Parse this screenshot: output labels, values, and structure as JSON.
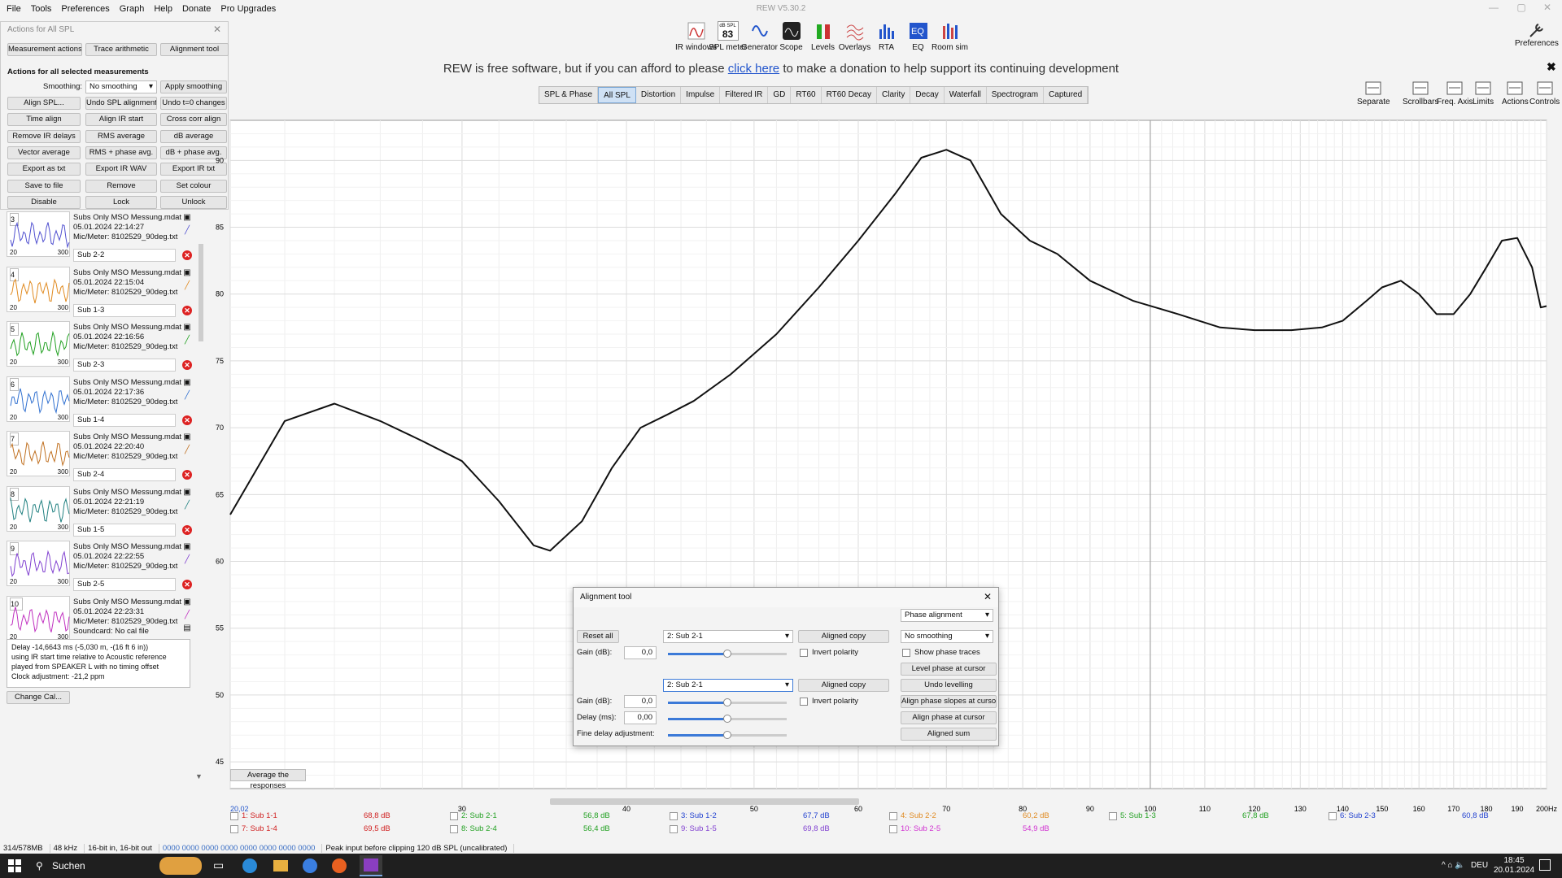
{
  "menu": [
    "File",
    "Tools",
    "Preferences",
    "Graph",
    "Help",
    "Donate",
    "Pro Upgrades"
  ],
  "app_title": "REW V5.30.2",
  "toolbar": [
    {
      "label": "IR windows",
      "icon": "ir-windows-icon"
    },
    {
      "label": "SPL meter",
      "icon": "spl-meter-icon",
      "badge_top": "dB SPL",
      "badge_value": "83"
    },
    {
      "label": "Generator",
      "icon": "generator-icon"
    },
    {
      "label": "Scope",
      "icon": "scope-icon"
    },
    {
      "label": "Levels",
      "icon": "levels-icon"
    },
    {
      "label": "Overlays",
      "icon": "overlays-icon"
    },
    {
      "label": "RTA",
      "icon": "rta-icon"
    },
    {
      "label": "EQ",
      "icon": "eq-icon"
    },
    {
      "label": "Room sim",
      "icon": "room-sim-icon"
    }
  ],
  "preferences_label": "Preferences",
  "donation": {
    "before": "REW is free software, but if you can afford to please ",
    "link": "click here",
    "after": " to make a donation to help support its continuing development"
  },
  "graph_tabs": [
    "SPL & Phase",
    "All SPL",
    "Distortion",
    "Impulse",
    "Filtered IR",
    "GD",
    "RT60",
    "RT60 Decay",
    "Clarity",
    "Decay",
    "Waterfall",
    "Spectrogram",
    "Captured"
  ],
  "active_tab": "All SPL",
  "right_tools": [
    "Separate",
    "Scrollbars",
    "Freq. Axis",
    "Limits",
    "Actions",
    "Controls"
  ],
  "actions_panel": {
    "title": "Actions for All SPL",
    "tabs": [
      "Measurement actions",
      "Trace arithmetic",
      "Alignment tool"
    ],
    "section": "Actions for all selected measurements",
    "smoothing_label": "Smoothing:",
    "smoothing_value": "No smoothing",
    "apply_smoothing": "Apply smoothing",
    "buttons": [
      [
        "Align SPL...",
        "Undo SPL alignment",
        "Undo t=0 changes"
      ],
      [
        "Time align",
        "Align IR start",
        "Cross corr align"
      ],
      [
        "Remove IR delays",
        "RMS average",
        "dB average"
      ],
      [
        "Vector average",
        "RMS + phase avg.",
        "dB + phase avg."
      ],
      [
        "Export as txt",
        "Export IR WAV",
        "Export IR txt"
      ],
      [
        "Save to file",
        "Remove",
        "Set colour"
      ],
      [
        "Disable",
        "Lock",
        "Unlock"
      ]
    ]
  },
  "measurements": [
    {
      "num": "3",
      "file": "Subs Only MSO Messung.mdat",
      "date": "05.01.2024 22:14:27",
      "cal": "Mic/Meter: 8102529_90deg.txt",
      "next_name": "Sub 2-2",
      "color": "#5050d0"
    },
    {
      "num": "4",
      "file": "Subs Only MSO Messung.mdat",
      "date": "05.01.2024 22:15:04",
      "cal": "Mic/Meter: 8102529_90deg.txt",
      "next_name": "Sub 1-3",
      "color": "#e08a20"
    },
    {
      "num": "5",
      "file": "Subs Only MSO Messung.mdat",
      "date": "05.01.2024 22:16:56",
      "cal": "Mic/Meter: 8102529_90deg.txt",
      "next_name": "Sub 2-3",
      "color": "#20a020"
    },
    {
      "num": "6",
      "file": "Subs Only MSO Messung.mdat",
      "date": "05.01.2024 22:17:36",
      "cal": "Mic/Meter: 8102529_90deg.txt",
      "next_name": "Sub 1-4",
      "color": "#3070d0"
    },
    {
      "num": "7",
      "file": "Subs Only MSO Messung.mdat",
      "date": "05.01.2024 22:20:40",
      "cal": "Mic/Meter: 8102529_90deg.txt",
      "next_name": "Sub 2-4",
      "color": "#c07020"
    },
    {
      "num": "8",
      "file": "Subs Only MSO Messung.mdat",
      "date": "05.01.2024 22:21:19",
      "cal": "Mic/Meter: 8102529_90deg.txt",
      "next_name": "Sub 1-5",
      "color": "#208080"
    },
    {
      "num": "9",
      "file": "Subs Only MSO Messung.mdat",
      "date": "05.01.2024 22:22:55",
      "cal": "Mic/Meter: 8102529_90deg.txt",
      "next_name": "Sub 2-5",
      "color": "#8040d0"
    },
    {
      "num": "10",
      "file": "Subs Only MSO Messung.mdat",
      "date": "05.01.2024 22:23:31",
      "cal": "Mic/Meter: 8102529_90deg.txt",
      "cal2": "Soundcard: No cal file",
      "color": "#c030c0"
    }
  ],
  "thumb_axis": {
    "min": "20",
    "max": "300"
  },
  "info_lines": [
    "Delay -14,6643 ms (-5,030 m, -(16 ft 6 in))",
    "using IR start time relative to Acoustic reference",
    "played from SPEAKER L with no timing offset",
    "Clock adjustment: -21,2 ppm"
  ],
  "change_cal": "Change Cal...",
  "average_button": "Average the responses",
  "graph": {
    "y_ticks": [
      "90",
      "85",
      "80",
      "75",
      "70",
      "65",
      "60",
      "55",
      "50",
      "45"
    ],
    "x_ticks": [
      "30",
      "40",
      "50",
      "60",
      "70",
      "80",
      "90",
      "100",
      "110",
      "120",
      "130",
      "140",
      "150",
      "160",
      "170",
      "180",
      "190",
      "200Hz"
    ],
    "x_start": "20,02"
  },
  "chart_data": {
    "type": "line",
    "xlabel": "",
    "ylabel": "",
    "xlim": [
      20,
      200
    ],
    "ylim": [
      43,
      93
    ],
    "x_scale": "log",
    "grid": true,
    "series": [
      {
        "color": "#111111",
        "points": [
          [
            20,
            63.5
          ],
          [
            22,
            70.5
          ],
          [
            24,
            71.8
          ],
          [
            26,
            70.5
          ],
          [
            28,
            69
          ],
          [
            30,
            67.5
          ],
          [
            32,
            64.5
          ],
          [
            34,
            61.2
          ],
          [
            35,
            60.8
          ],
          [
            37,
            63
          ],
          [
            39,
            67
          ],
          [
            41,
            70
          ],
          [
            43,
            71
          ],
          [
            45,
            72
          ],
          [
            48,
            74
          ],
          [
            52,
            77
          ],
          [
            56,
            80.5
          ],
          [
            60,
            84
          ],
          [
            64,
            87.5
          ],
          [
            67,
            90.2
          ],
          [
            70,
            90.8
          ],
          [
            73,
            90
          ],
          [
            77,
            86
          ],
          [
            81,
            84
          ],
          [
            85,
            83
          ],
          [
            90,
            81
          ],
          [
            97,
            79.5
          ],
          [
            105,
            78.5
          ],
          [
            113,
            77.5
          ],
          [
            120,
            77.3
          ],
          [
            128,
            77.3
          ],
          [
            135,
            77.5
          ],
          [
            140,
            78
          ],
          [
            146,
            79.5
          ],
          [
            150,
            80.5
          ],
          [
            155,
            81
          ],
          [
            160,
            80
          ],
          [
            165,
            78.5
          ],
          [
            170,
            78.5
          ],
          [
            175,
            80
          ],
          [
            180,
            82
          ],
          [
            185,
            84
          ],
          [
            190,
            84.2
          ],
          [
            195,
            82
          ],
          [
            198,
            79
          ],
          [
            200,
            79.1
          ]
        ]
      }
    ]
  },
  "legend": [
    {
      "label": "1: Sub 1-1",
      "value": "68,8 dB",
      "color": "#d02020"
    },
    {
      "label": "2: Sub 2-1",
      "value": "56,8 dB",
      "color": "#20a020"
    },
    {
      "label": "3: Sub 1-2",
      "value": "67,7 dB",
      "color": "#2040d0"
    },
    {
      "label": "4: Sub 2-2",
      "value": "60,2 dB",
      "color": "#e08a20"
    },
    {
      "label": "5: Sub 1-3",
      "value": "67,8 dB",
      "color": "#20a020"
    },
    {
      "label": "6: Sub 2-3",
      "value": "60,8 dB",
      "color": "#2040d0"
    },
    {
      "label": "7: Sub 1-4",
      "value": "69,5 dB",
      "color": "#d02020"
    },
    {
      "label": "8: Sub 2-4",
      "value": "56,4 dB",
      "color": "#20a020"
    },
    {
      "label": "9: Sub 1-5",
      "value": "69,8 dB",
      "color": "#8040d0"
    },
    {
      "label": "10: Sub 2-5",
      "value": "54,9 dB",
      "color": "#d030d0"
    }
  ],
  "status": {
    "mem": "314/578MB",
    "rate": "48 kHz",
    "bits": "16-bit in, 16-bit out",
    "levels": "0000 0000  0000 0000  0000 0000  0000 0000",
    "peak": "Peak input before clipping 120 dB SPL (uncalibrated)"
  },
  "taskbar": {
    "search": "Suchen",
    "lang": "DEU",
    "time": "18:45",
    "date": "20.01.2024"
  },
  "dialog": {
    "title": "Alignment tool",
    "mode": "Phase alignment",
    "reset_all": "Reset all",
    "sel1": "2: Sub 2-1",
    "aligned_copy": "Aligned copy",
    "smoothing": "No smoothing",
    "gain_label": "Gain (dB):",
    "gain1": "0,0",
    "invert": "Invert polarity",
    "show_phase": "Show phase traces",
    "level_phase": "Level phase at cursor",
    "sel2": "2: Sub 2-1",
    "undo_levelling": "Undo levelling",
    "gain2": "0,0",
    "align_slopes": "Align phase slopes at cursor",
    "delay_label": "Delay (ms):",
    "delay": "0,00",
    "align_phase": "Align phase at cursor",
    "fine_delay": "Fine delay adjustment:",
    "aligned_sum": "Aligned sum",
    "slider_levels": {
      "gain1": 0.5,
      "gain2": 0.5,
      "delay": 0.5,
      "fine": 0.5
    }
  }
}
